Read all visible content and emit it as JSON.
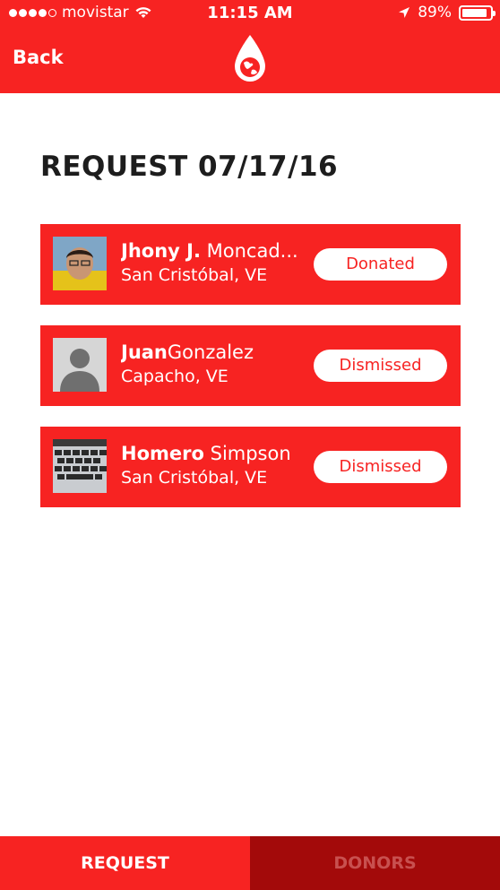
{
  "status_bar": {
    "carrier": "movistar",
    "time": "11:15 AM",
    "battery": "89%",
    "battery_level": 0.89
  },
  "header": {
    "back_label": "Back",
    "logo_icon": "blood-drop-globe-icon"
  },
  "page": {
    "title": "REQUEST 07/17/16"
  },
  "donors": [
    {
      "first_name": "Jhony J.",
      "last_name": "Moncad...",
      "location": "San Cristóbal, VE",
      "status": "Donated",
      "avatar": "photo-man"
    },
    {
      "first_name": "Juan",
      "last_name": "Gonzalez",
      "location": "Capacho, VE",
      "status": "Dismissed",
      "avatar": "placeholder-person-icon"
    },
    {
      "first_name": "Homero",
      "last_name": "Simpson",
      "location": "San Cristóbal, VE",
      "status": "Dismissed",
      "avatar": "photo-keyboard"
    }
  ],
  "tabs": [
    {
      "label": "REQUEST",
      "active": true
    },
    {
      "label": "DONORS",
      "active": false
    }
  ],
  "colors": {
    "primary": "#f72322",
    "tab_inactive": "#a30a0a",
    "title_text": "#1d1d1d"
  }
}
